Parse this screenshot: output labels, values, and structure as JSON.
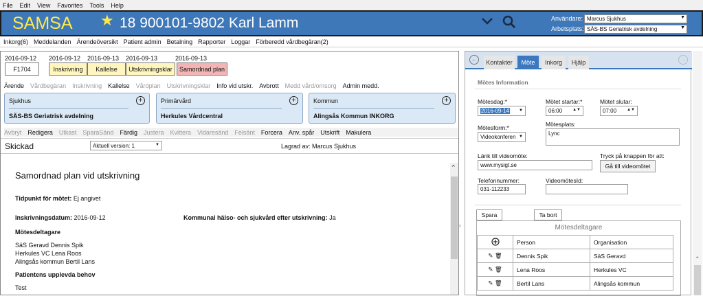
{
  "menu": [
    "File",
    "Edit",
    "View",
    "Favorites",
    "Tools",
    "Help"
  ],
  "banner": {
    "logo": "SAMSA",
    "patient": "18 900101-9802 Karl Lamm",
    "user_label": "Användare:",
    "user_value": "Marcus Sjukhus",
    "workplace_label": "Arbetsplats:",
    "workplace_value": "SÄS-BS Geriatrisk avdelning",
    "colors": {
      "banner": "#3e78b9",
      "logo": "#ffe84a"
    }
  },
  "nav": [
    "Inkorg(6)",
    "Meddelanden",
    "Ärendeöversikt",
    "Patient admin",
    "Betalning",
    "Rapporter",
    "Loggar",
    "Förberedd vårdbegäran(2)"
  ],
  "flow": [
    {
      "date": "2016-09-12",
      "label": "F1704",
      "color": "#ffffff"
    },
    {
      "date": "2016-09-12",
      "label": "Inskrivning",
      "color": "#fff6bf"
    },
    {
      "date": "2016-09-13",
      "label": "Kallelse",
      "color": "#fff6bf"
    },
    {
      "date": "2016-09-13",
      "label": "Utskrivningsklar",
      "color": "#fff6bf"
    },
    {
      "date": "2016-09-13",
      "label": "Samordnad plan",
      "color": "#f2b5b5"
    }
  ],
  "toolbar1": [
    {
      "label": "Ärende",
      "enabled": true
    },
    {
      "label": "Vårdbegäran",
      "enabled": false
    },
    {
      "label": "Inskrivning",
      "enabled": false
    },
    {
      "label": "Kallelse",
      "enabled": true
    },
    {
      "label": "Vårdplan",
      "enabled": false
    },
    {
      "label": "Utskrivningsklar",
      "enabled": false
    },
    {
      "label": "Info vid utskr.",
      "enabled": true
    },
    {
      "label": "Avbrott",
      "enabled": true
    },
    {
      "label": "Medd vård/omsorg",
      "enabled": false
    },
    {
      "label": "Admin medd.",
      "enabled": true
    }
  ],
  "cards": [
    {
      "title": "Sjukhus",
      "value": "SÄS-BS Geriatrisk avdelning"
    },
    {
      "title": "Primärvård",
      "value": "Herkules Vårdcentral"
    },
    {
      "title": "Kommun",
      "value": "Alingsås Kommun INKORG"
    }
  ],
  "toolbar2": [
    {
      "label": "Avbryt",
      "enabled": false
    },
    {
      "label": "Redigera",
      "enabled": true
    },
    {
      "label": "Utkast",
      "enabled": false
    },
    {
      "label": "SparaSänd",
      "enabled": false
    },
    {
      "label": "Färdig",
      "enabled": true
    },
    {
      "label": "Justera",
      "enabled": false
    },
    {
      "label": "Kvittera",
      "enabled": false
    },
    {
      "label": "Vidaresänd",
      "enabled": false
    },
    {
      "label": "Felsänt",
      "enabled": false
    },
    {
      "label": "Forcera",
      "enabled": true
    },
    {
      "label": "Anv. spår",
      "enabled": true
    },
    {
      "label": "Utskrift",
      "enabled": true
    },
    {
      "label": "Makulera",
      "enabled": true
    }
  ],
  "status": {
    "title": "Skickad",
    "version": "Aktuell version: 1",
    "saved_by": "Lagrad av: Marcus Sjukhus"
  },
  "doc": {
    "heading": "Samordnad plan vid utskrivning",
    "meeting_time_label": "Tidpunkt för mötet:",
    "meeting_time_value": "Ej angivet",
    "admission_label": "Inskrivningsdatum:",
    "admission_value": "2016-09-12",
    "municipal_label": "Kommunal hälso- och sjukvård efter utskrivning:",
    "municipal_value": "Ja",
    "participants_heading": "Mötesdeltagare",
    "participants": [
      "SäS Geravd Dennis Spik",
      "Herkules VC Lena Roos",
      "Alingsås kommun Bertil Lans"
    ],
    "needs_heading": "Patientens upplevda behov",
    "needs_value": "Test"
  },
  "right": {
    "tabs": [
      "Kontakter",
      "Möte",
      "Inkorg",
      "Hjälp"
    ],
    "active_tab": "Möte",
    "section": "Mötes Information",
    "date_label": "Mötesdag:*",
    "date_value": "2016-09-14",
    "start_label": "Mötet startar:*",
    "start_value": "06:00",
    "end_label": "Mötet slutar:",
    "end_value": "07:00",
    "form_label": "Mötesform:*",
    "form_value": "Videokonferen",
    "place_label": "Mötesplats:",
    "place_value": "Lync",
    "link_label": "Länk till videomöte:",
    "link_value": "www.mysigt.se",
    "press_label": "Tryck på knappen för att:",
    "goto_button": "Gå till videomötet",
    "phone_label": "Telefonnummer:",
    "phone_value": "031-112233",
    "videoid_label": "VideomötesId:",
    "videoid_value": "",
    "save_button": "Spara",
    "delete_button": "Ta bort",
    "participants_title": "Mötesdeltagare",
    "col_person": "Person",
    "col_org": "Organisation",
    "rows": [
      {
        "person": "Dennis Spik",
        "org": "SäS Geravd"
      },
      {
        "person": "Lena Roos",
        "org": "Herkules VC"
      },
      {
        "person": "Bertil Lans",
        "org": "Alingsås kommun"
      }
    ]
  }
}
